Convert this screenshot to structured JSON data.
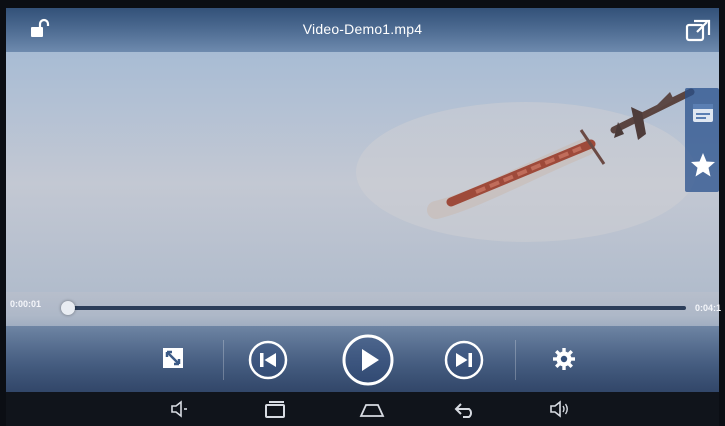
{
  "header": {
    "title": "Video-Demo1.mp4"
  },
  "playback": {
    "elapsed": "0:00:01",
    "total": "0:04:1",
    "progress": 0.004
  },
  "icons": {
    "lock": "unlock-icon",
    "popup": "popup-window-icon",
    "subtitle": "subtitle-icon",
    "favorite": "star-icon",
    "fullscreen": "fullscreen-icon",
    "prev": "skip-previous-icon",
    "play": "play-icon",
    "next": "skip-next-icon",
    "settings": "gear-icon",
    "nav": [
      "volume-down-icon",
      "recent-apps-icon",
      "home-icon",
      "back-icon",
      "volume-up-icon"
    ]
  },
  "colors": {
    "bar": "#2e4f7c",
    "progress_fill": "#dfe6f0",
    "progress_track": "#2c3e5a",
    "text": "#ffffff"
  }
}
